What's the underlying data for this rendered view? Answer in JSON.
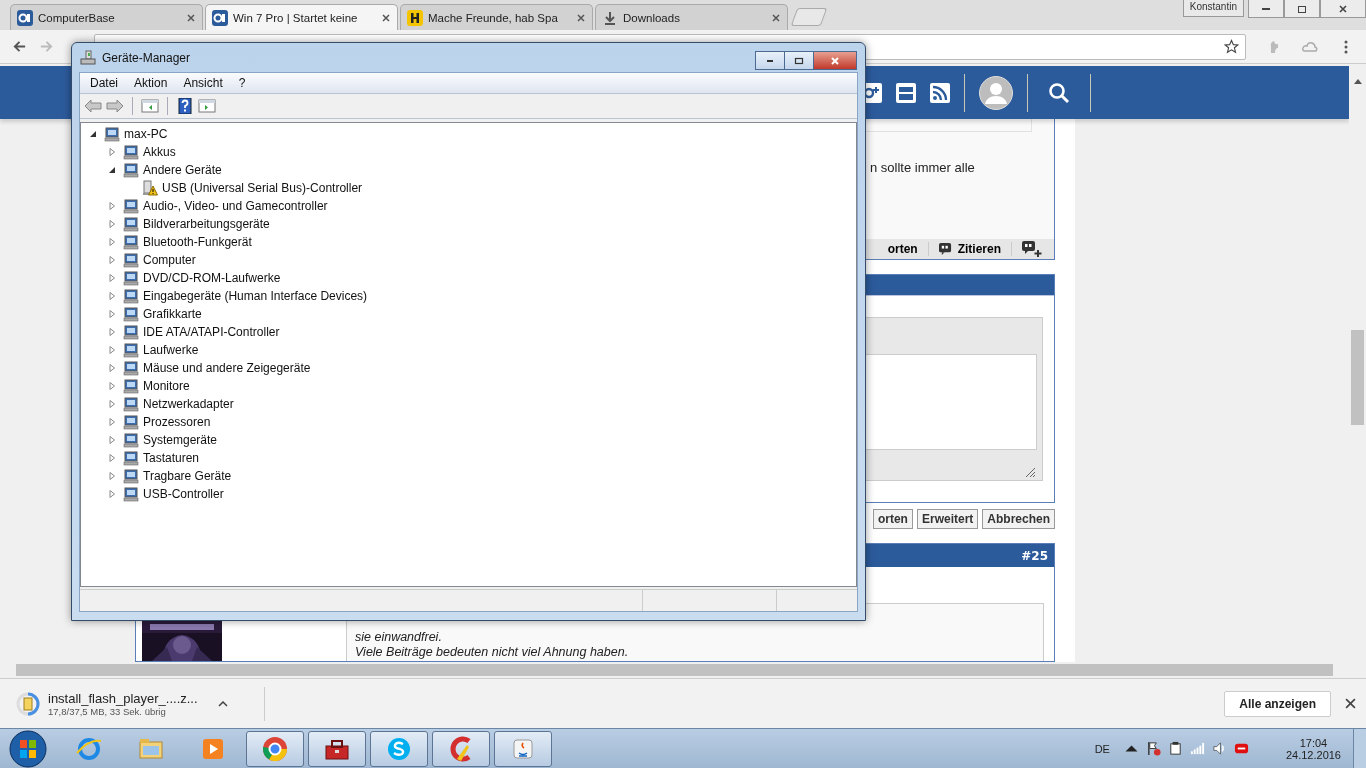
{
  "browser": {
    "tabs": [
      {
        "title": "ComputerBase",
        "selected": false
      },
      {
        "title": "Win 7 Pro | Startet keine",
        "selected": true
      },
      {
        "title": "Mache Freunde, hab Spa",
        "selected": false
      },
      {
        "title": "Downloads",
        "selected": false
      }
    ],
    "profile": "Konstantin",
    "back": {
      "disabled": false
    },
    "forward": {
      "disabled": true
    }
  },
  "page": {
    "post_text": "n sollte immer alle",
    "post_actions": [
      "orten",
      "Zitieren"
    ],
    "reply_buttons": [
      "orten",
      "Erweitert",
      "Abbrechen"
    ],
    "post_number": "#25",
    "post_body": [
      "sie einwandfrei.",
      "Viele Beiträge bedeuten nicht viel Ahnung haben."
    ]
  },
  "device_manager": {
    "title": "Geräte-Manager",
    "menu": [
      "Datei",
      "Aktion",
      "Ansicht",
      "?"
    ],
    "toolbar": {
      "back": {
        "disabled": true
      },
      "forward": {
        "disabled": true
      }
    },
    "tree": {
      "label": "max-PC",
      "expanded": true,
      "children": [
        {
          "label": "Akkus",
          "expanded": false
        },
        {
          "label": "Andere Geräte",
          "expanded": true,
          "children": [
            {
              "label": "USB (Universal Serial Bus)-Controller",
              "warning": true
            }
          ]
        },
        {
          "label": "Audio-, Video- und Gamecontroller",
          "expanded": false
        },
        {
          "label": "Bildverarbeitungsgeräte",
          "expanded": false
        },
        {
          "label": "Bluetooth-Funkgerät",
          "expanded": false
        },
        {
          "label": "Computer",
          "expanded": false
        },
        {
          "label": "DVD/CD-ROM-Laufwerke",
          "expanded": false
        },
        {
          "label": "Eingabegeräte (Human Interface Devices)",
          "expanded": false
        },
        {
          "label": "Grafikkarte",
          "expanded": false
        },
        {
          "label": "IDE ATA/ATAPI-Controller",
          "expanded": false
        },
        {
          "label": "Laufwerke",
          "expanded": false
        },
        {
          "label": "Mäuse und andere Zeigegeräte",
          "expanded": false
        },
        {
          "label": "Monitore",
          "expanded": false
        },
        {
          "label": "Netzwerkadapter",
          "expanded": false
        },
        {
          "label": "Prozessoren",
          "expanded": false
        },
        {
          "label": "Systemgeräte",
          "expanded": false
        },
        {
          "label": "Tastaturen",
          "expanded": false
        },
        {
          "label": "Tragbare Geräte",
          "expanded": false
        },
        {
          "label": "USB-Controller",
          "expanded": false
        }
      ]
    }
  },
  "downloads": {
    "file": "install_flash_player_....z...",
    "status": "17,8/37,5 MB, 33 Sek. übrig",
    "show_all": "Alle anzeigen"
  },
  "taskbar": {
    "apps": [
      {
        "running": false
      },
      {
        "running": false
      },
      {
        "running": false
      },
      {
        "running": true
      },
      {
        "running": true
      },
      {
        "running": true
      },
      {
        "running": true
      },
      {
        "running": true
      }
    ],
    "language": "DE",
    "time": "17:04",
    "date": "24.12.2016"
  }
}
